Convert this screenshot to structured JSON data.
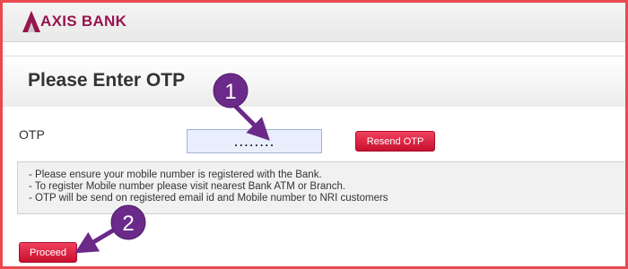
{
  "header": {
    "brand_name": "AXIS BANK"
  },
  "page": {
    "title": "Please Enter OTP"
  },
  "otp": {
    "label": "OTP",
    "value": "........",
    "resend_label": "Resend OTP"
  },
  "notes": [
    "- Please ensure your mobile number is registered with the Bank.",
    "- To register Mobile number please visit nearest Bank ATM or Branch.",
    "- OTP will be send on registered email id and Mobile number to NRI customers"
  ],
  "actions": {
    "proceed_label": "Proceed"
  },
  "annotations": [
    {
      "number": "1"
    },
    {
      "number": "2"
    }
  ],
  "colors": {
    "brand": "#97144d",
    "button": "#c8102e",
    "annotation": "#6b2a8a",
    "frame": "#e84a4f"
  }
}
